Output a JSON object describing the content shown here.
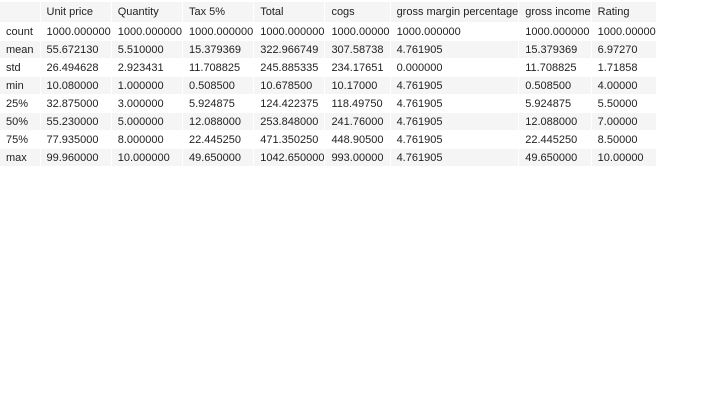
{
  "table": {
    "columns": [
      "",
      "Unit price",
      "Quantity",
      "Tax 5%",
      "Total",
      "cogs",
      "gross margin percentage",
      "gross income",
      "Rating"
    ],
    "rows": [
      {
        "label": "count",
        "values": [
          "1000.000000",
          "1000.000000",
          "1000.000000",
          "1000.000000",
          "1000.00000",
          "1000.000000",
          "1000.000000",
          "1000.00000"
        ]
      },
      {
        "label": "mean",
        "values": [
          "55.672130",
          "5.510000",
          "15.379369",
          "322.966749",
          "307.58738",
          "4.761905",
          "15.379369",
          "6.97270"
        ]
      },
      {
        "label": "std",
        "values": [
          "26.494628",
          "2.923431",
          "11.708825",
          "245.885335",
          "234.17651",
          "0.000000",
          "11.708825",
          "1.71858"
        ]
      },
      {
        "label": "min",
        "values": [
          "10.080000",
          "1.000000",
          "0.508500",
          "10.678500",
          "10.17000",
          "4.761905",
          "0.508500",
          "4.00000"
        ]
      },
      {
        "label": "25%",
        "values": [
          "32.875000",
          "3.000000",
          "5.924875",
          "124.422375",
          "118.49750",
          "4.761905",
          "5.924875",
          "5.50000"
        ]
      },
      {
        "label": "50%",
        "values": [
          "55.230000",
          "5.000000",
          "12.088000",
          "253.848000",
          "241.76000",
          "4.761905",
          "12.088000",
          "7.00000"
        ]
      },
      {
        "label": "75%",
        "values": [
          "77.935000",
          "8.000000",
          "22.445250",
          "471.350250",
          "448.90500",
          "4.761905",
          "22.445250",
          "8.50000"
        ]
      },
      {
        "label": "max",
        "values": [
          "99.960000",
          "10.000000",
          "49.650000",
          "1042.650000",
          "993.00000",
          "4.761905",
          "49.650000",
          "10.00000"
        ]
      }
    ]
  }
}
